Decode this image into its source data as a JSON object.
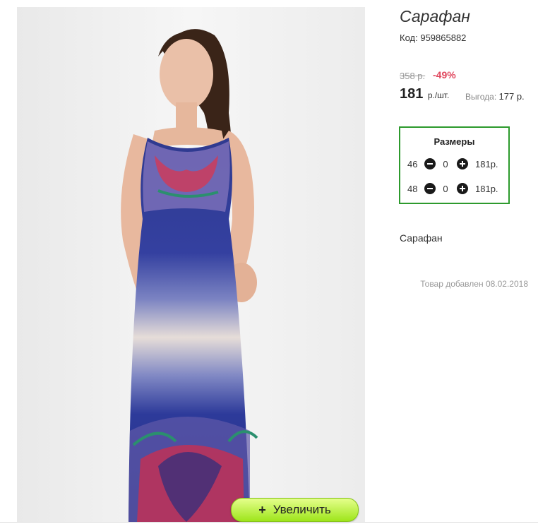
{
  "product": {
    "title": "Сарафан",
    "code_label": "Код:",
    "code": "959865882",
    "old_price": "358 р.",
    "discount": "-49%",
    "price": "181",
    "price_unit": "р./шт.",
    "benefit_label": "Выгода:",
    "benefit_value": "177 р.",
    "description": "Сарафан",
    "added_label": "Товар добавлен",
    "added_date": "08.02.2018"
  },
  "sizes": {
    "title": "Размеры",
    "rows": [
      {
        "size": "46",
        "qty": "0",
        "price": "181р."
      },
      {
        "size": "48",
        "qty": "0",
        "price": "181р."
      }
    ]
  },
  "zoom": {
    "plus": "+",
    "label": "Увеличить"
  },
  "colors": {
    "accent_green": "#2d9a2d",
    "discount_red": "#e0455c",
    "button_green": "#9ee51b"
  }
}
